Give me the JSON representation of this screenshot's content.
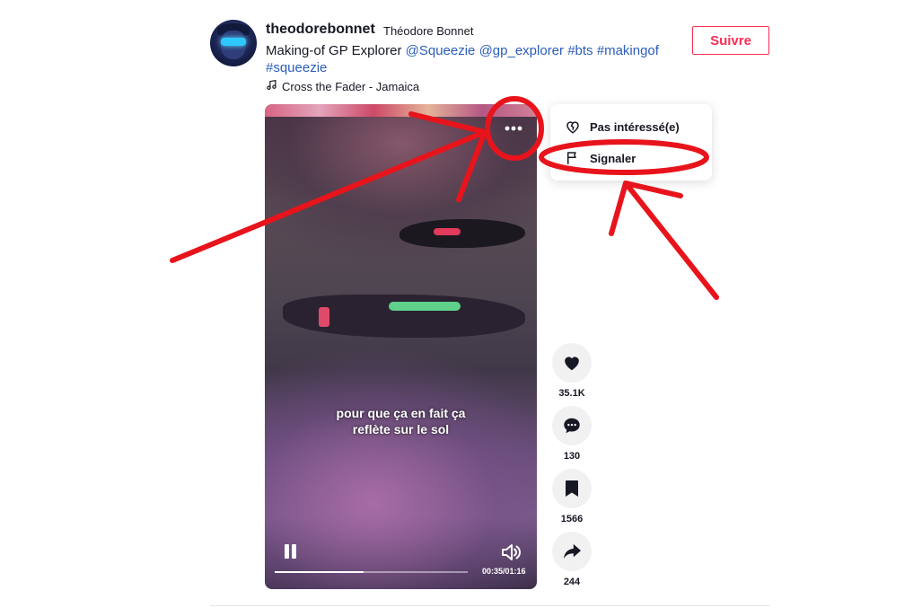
{
  "author": {
    "username": "theodorebonnet",
    "display_name": "Théodore Bonnet"
  },
  "caption": {
    "text": "Making-of GP Explorer",
    "mentions": [
      "@Squeezie",
      "@gp_explorer"
    ],
    "hashtags": [
      "#bts",
      "#makingof",
      "#squeezie"
    ]
  },
  "music": {
    "track": "Cross the Fader - Jamaica",
    "icon": "music-note-icon"
  },
  "follow_label": "Suivre",
  "video": {
    "subtitle_line1": "pour que ça en fait ça",
    "subtitle_line2": "reflète sur le sol",
    "time": "00:35/01:16",
    "progress": 0.46
  },
  "menu": {
    "items": [
      {
        "label": "Pas intéressé(e)",
        "icon": "heart-broken-icon"
      },
      {
        "label": "Signaler",
        "icon": "flag-icon"
      }
    ]
  },
  "actions": {
    "likes": "35.1K",
    "comments": "130",
    "saves": "1566",
    "shares": "244"
  },
  "colors": {
    "follow": "#fe2c55",
    "link": "#2b5db9",
    "annotation": "#e8141c"
  }
}
